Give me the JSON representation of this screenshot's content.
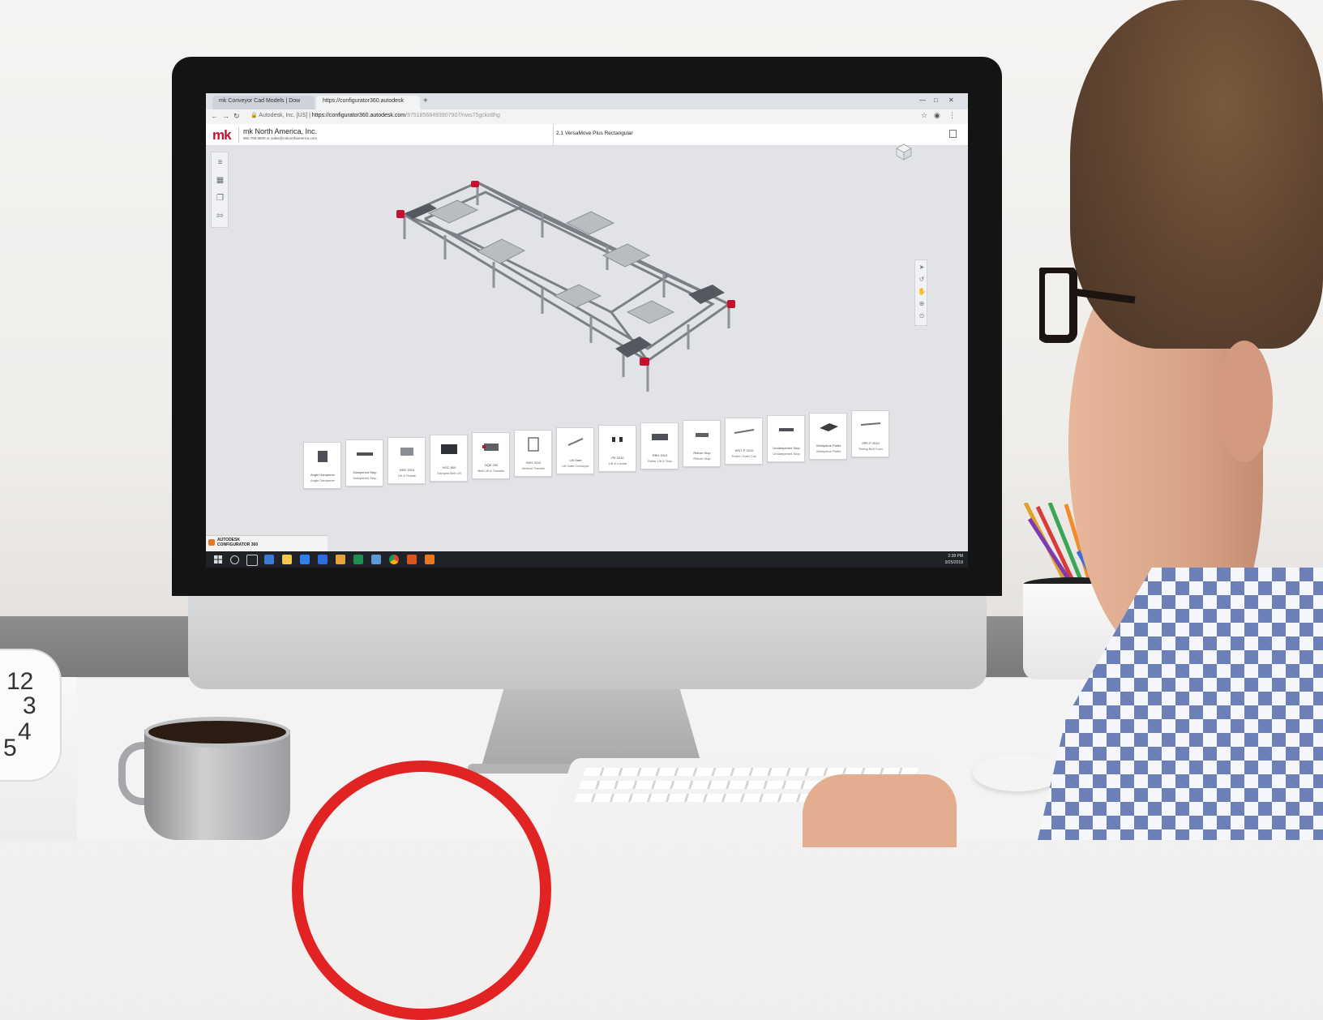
{
  "browser": {
    "tabs": [
      {
        "label": "mk Conveyor Cad Models | Dow"
      },
      {
        "label": "https://configurator360.autodesk"
      }
    ],
    "new_tab": "+",
    "url_secure_label": "Autodesk, Inc. [US]",
    "url_host": "https://configurator360.autodesk.com",
    "url_path": "/97518568493907907/nws75gcko8hg"
  },
  "app": {
    "company": "mk North America, Inc.",
    "contact": "860.769.5500 or sales@mknorthamerica.com",
    "model_title": "2.1 VersaMove Plus Rectangular",
    "logo_text": "mk"
  },
  "thumbnails": [
    {
      "line1": "Angle Dampener",
      "line2": "Angle Dampener"
    },
    {
      "line1": "Dampened Stop",
      "line2": "Dampened Stop"
    },
    {
      "line1": "HDE 2010",
      "line2": "Lift & Rotate"
    },
    {
      "line1": "HGC 800",
      "line2": "Damped Belt Lift"
    },
    {
      "line1": "HQE 200",
      "line2": "Belt Lift & Transfer"
    },
    {
      "line1": "HUH 2010",
      "line2": "Vertical Transfer"
    },
    {
      "line1": "Lift Gate",
      "line2": "Lift Gate Conveyor"
    },
    {
      "line1": "PE 2010",
      "line2": "Lift & Locate"
    },
    {
      "line1": "RBH 2010",
      "line2": "Roller Lift & Tran"
    },
    {
      "line1": "Return Stop",
      "line2": "Return Stop"
    },
    {
      "line1": "WST-P 2010",
      "line2": "Roller Chain Con"
    },
    {
      "line1": "Undampened Stop",
      "line2": "Undampened Stop"
    },
    {
      "line1": "Workpiece Pallet",
      "line2": "Workpiece Pallet"
    },
    {
      "line1": "ZRF-P 2010",
      "line2": "Timing Belt Conv"
    }
  ],
  "taskbar": {
    "app_badge_line1": "AUTODESK",
    "app_badge_line2": "CONFIGURATOR 360",
    "time": "2:38 PM",
    "date": "9/25/2018"
  },
  "clock": {
    "numbers": [
      "12",
      "3",
      "4",
      "5"
    ]
  },
  "colors": {
    "brand_red": "#c8102e",
    "viewport_bg": "#e2e3e6",
    "taskbar": "#1f2226",
    "accent_red": "#e22323"
  }
}
